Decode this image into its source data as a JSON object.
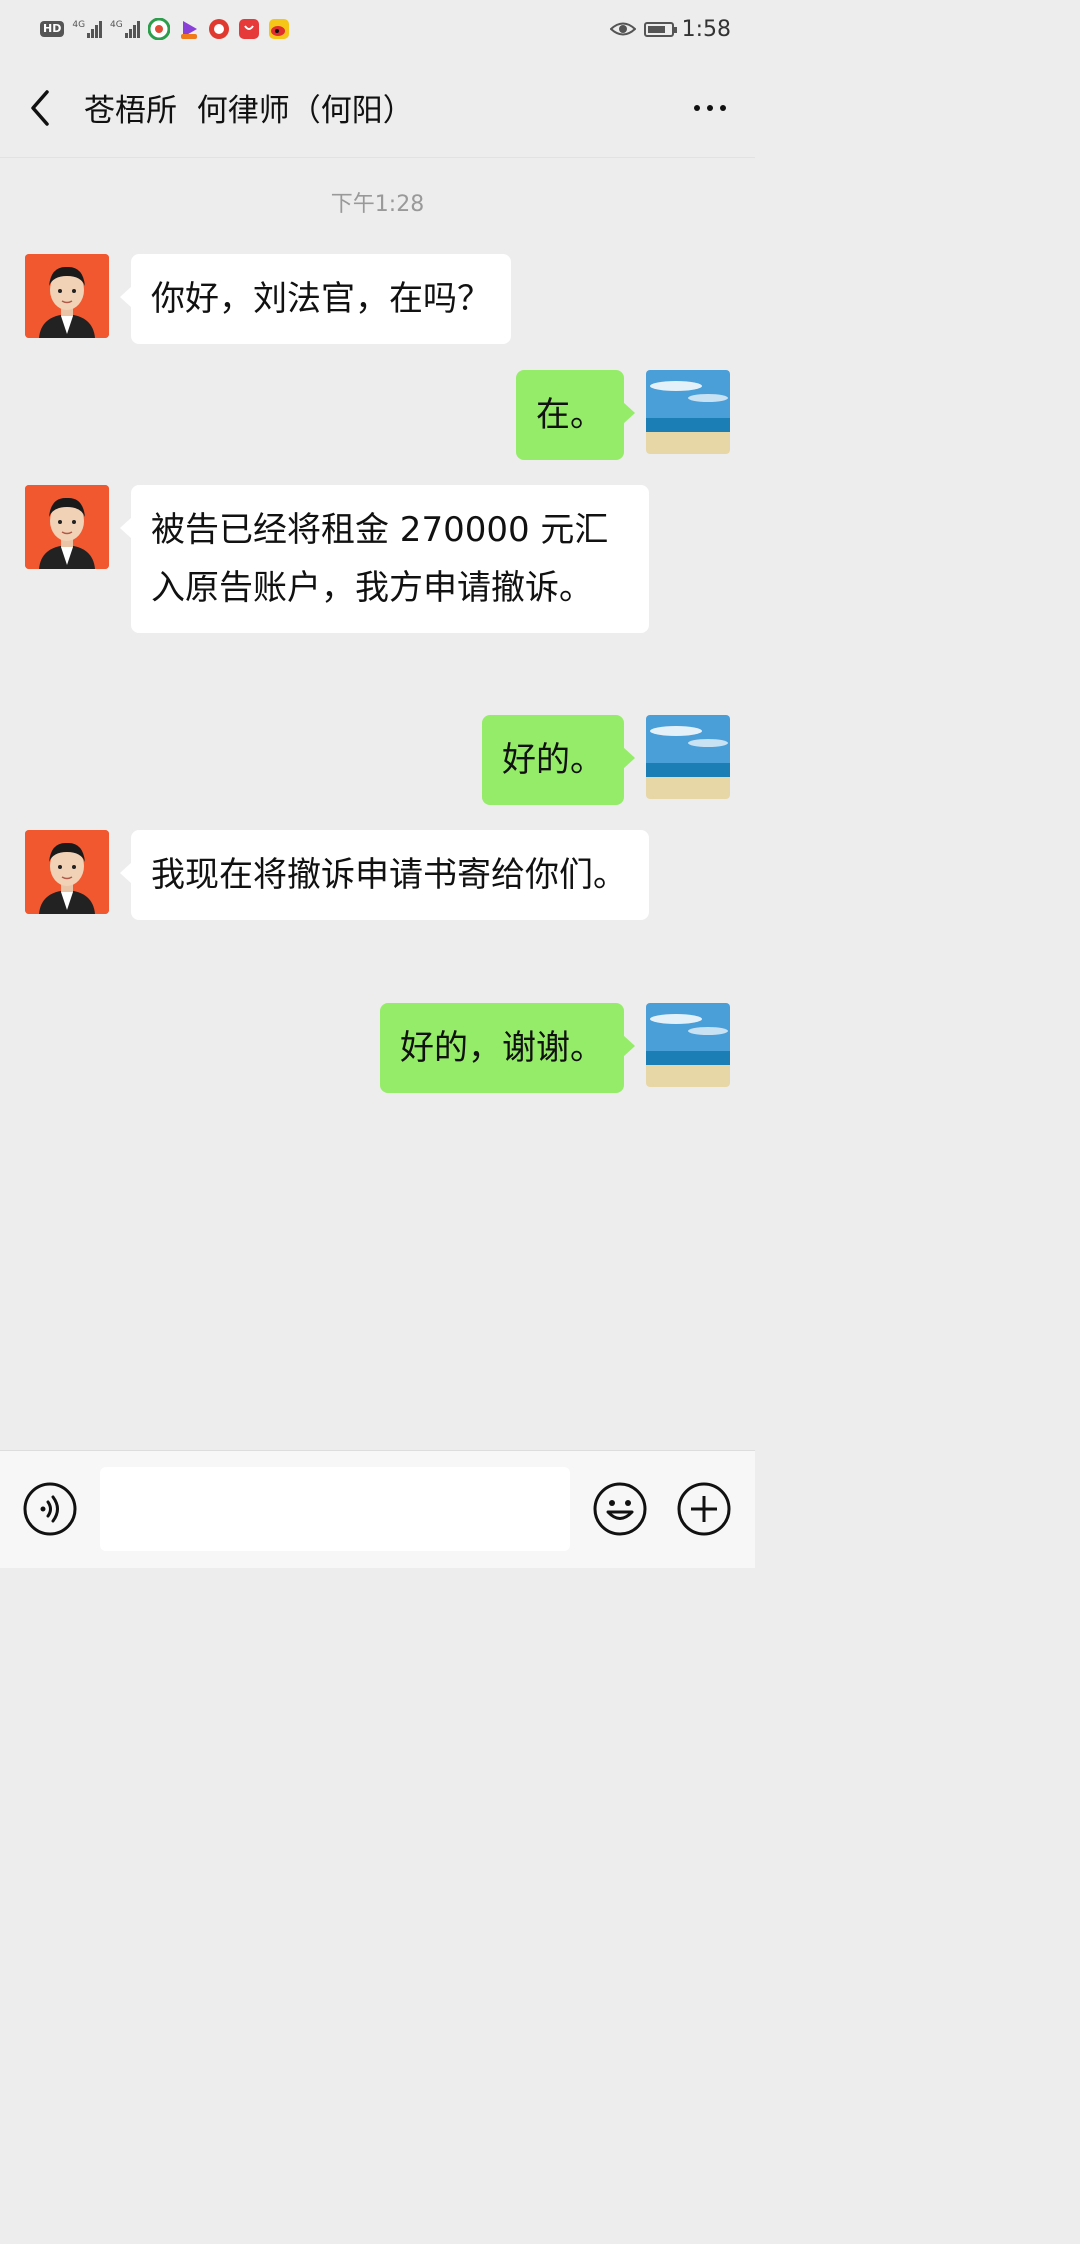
{
  "status_bar": {
    "hd": "HD",
    "network_1": "4G",
    "network_2": "4G",
    "time": "1:58"
  },
  "header": {
    "title": "苍梧所  何律师（何阳）"
  },
  "chat": {
    "timestamp": "下午1:28",
    "messages": [
      {
        "side": "left",
        "text": "你好，刘法官，在吗？"
      },
      {
        "side": "right",
        "text": "在。"
      },
      {
        "side": "left",
        "text": "被告已经将租金 270000 元汇入原告账户，我方申请撤诉。"
      },
      {
        "side": "right",
        "text": "好的。"
      },
      {
        "side": "left",
        "text": "我现在将撤诉申请书寄给你们。"
      },
      {
        "side": "right",
        "text": "好的，谢谢。"
      }
    ]
  },
  "input": {
    "value": "",
    "placeholder": ""
  },
  "colors": {
    "background": "#ededed",
    "sent_bubble": "#95ec69",
    "received_bubble": "#ffffff",
    "avatar_bg": "#f2582f"
  },
  "icons": [
    "back-arrow-icon",
    "more-icon",
    "voice-icon",
    "emoji-icon",
    "plus-icon"
  ]
}
